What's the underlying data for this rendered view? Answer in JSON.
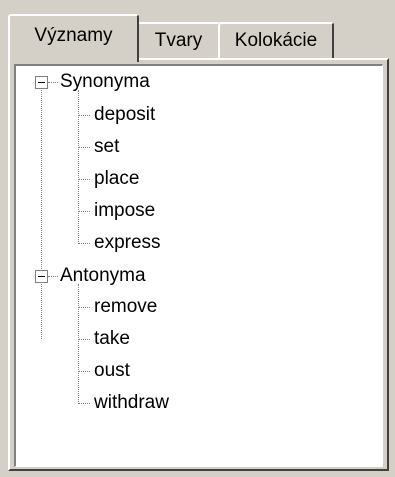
{
  "tabs": [
    {
      "label": "Významy",
      "active": true
    },
    {
      "label": "Tvary",
      "active": false
    },
    {
      "label": "Kolokácie",
      "active": false
    }
  ],
  "tree": {
    "groups": [
      {
        "label": "Synonyma",
        "expanded": true,
        "expander_icon": "minus-box-icon",
        "items": [
          "deposit",
          "set",
          "place",
          "impose",
          "express"
        ]
      },
      {
        "label": "Antonyma",
        "expanded": true,
        "expander_icon": "minus-box-icon",
        "items": [
          "remove",
          "take",
          "oust",
          "withdraw"
        ]
      }
    ]
  },
  "colors": {
    "window_bg": "#d4d0c8",
    "tree_bg": "#ffffff",
    "connector": "#808080",
    "text": "#000000"
  }
}
